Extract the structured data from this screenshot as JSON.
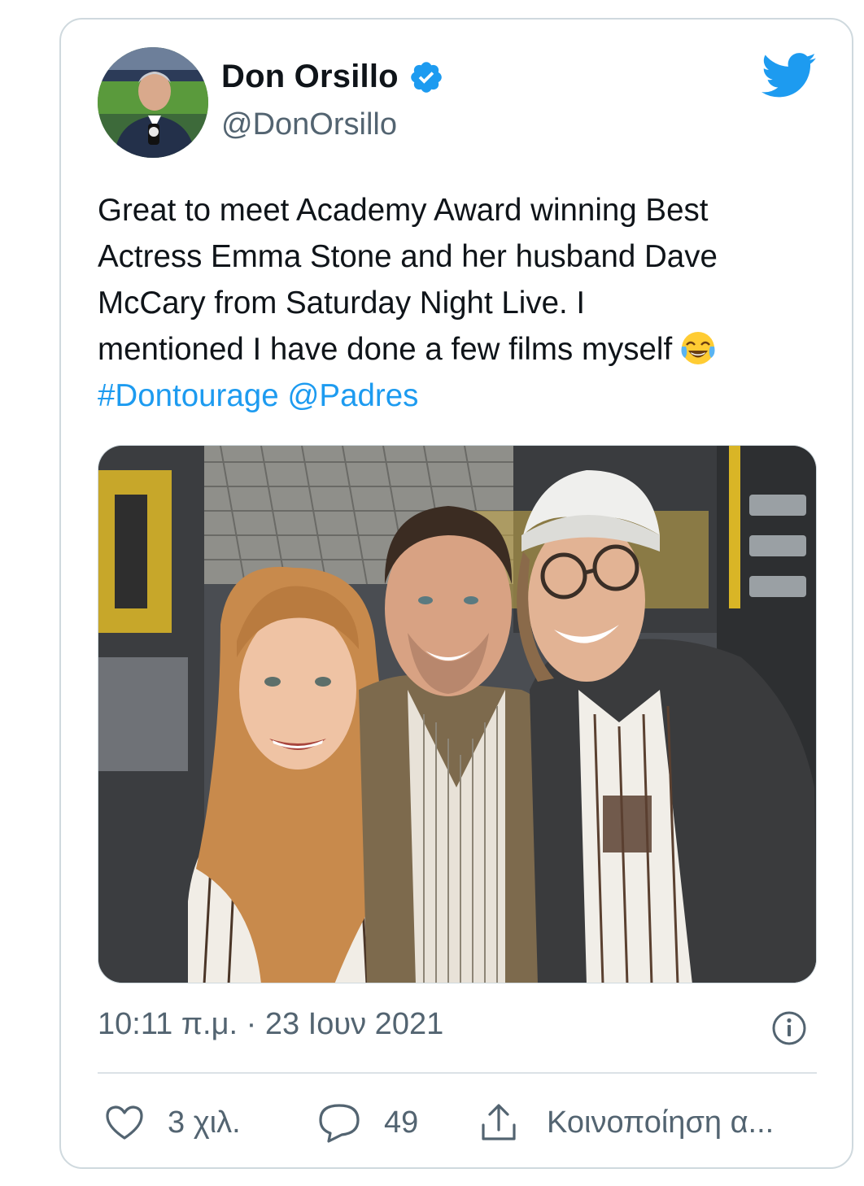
{
  "tweet": {
    "author": {
      "display_name": "Don Orsillo",
      "handle": "@DonOrsillo",
      "verified": true,
      "avatar_icon": "avatar-photo"
    },
    "brand_icon": "twitter-bird-icon",
    "text_lines": [
      "Great to meet Academy Award winning Best",
      "Actress Emma Stone and her husband Dave",
      "McCary from Saturday Night Live. I",
      "mentioned I have done a few films myself"
    ],
    "emoji": "😂",
    "hashtag": "#Dontourage",
    "mention": "@Padres",
    "timestamp": "10:11 π.μ. · 23 Ιουν 2021",
    "actions": {
      "like_count": "3 χιλ.",
      "reply_count": "49",
      "share_label": "Κοινοποίηση α..."
    }
  },
  "colors": {
    "link": "#1d9bf0",
    "secondary_text": "#536471",
    "border": "#cfd9de",
    "verified_badge": "#1d9bf0"
  }
}
